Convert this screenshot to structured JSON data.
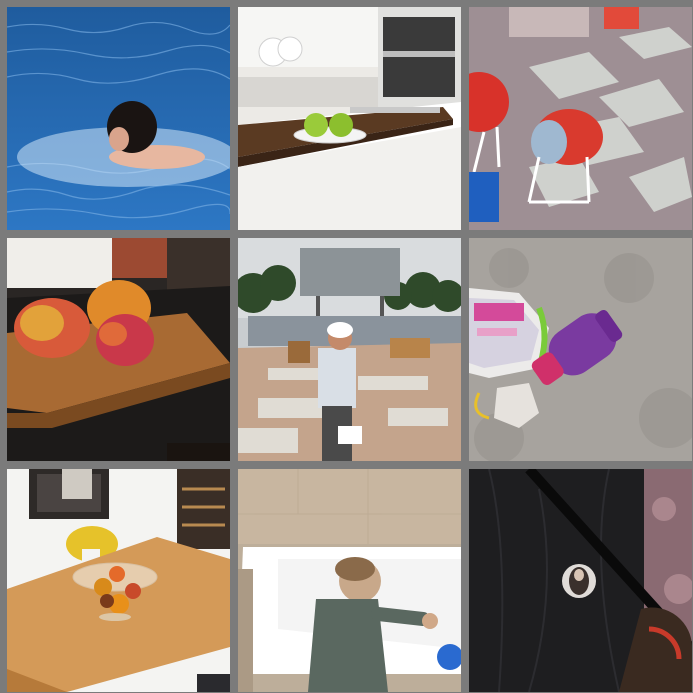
{
  "grid": {
    "rows": 3,
    "columns": 3,
    "background_color": "#7b7b7b",
    "tiles": [
      {
        "subject": "swimmer-in-pool"
      },
      {
        "subject": "kitchen-island-with-apples"
      },
      {
        "subject": "patio-chairs"
      },
      {
        "subject": "mangoes-on-wooden-tray"
      },
      {
        "subject": "construction-site-worker"
      },
      {
        "subject": "toys-on-carpet"
      },
      {
        "subject": "fruit-bowl-on-table"
      },
      {
        "subject": "toddler-at-bathtub"
      },
      {
        "subject": "dark-jacket-with-pin"
      }
    ]
  }
}
